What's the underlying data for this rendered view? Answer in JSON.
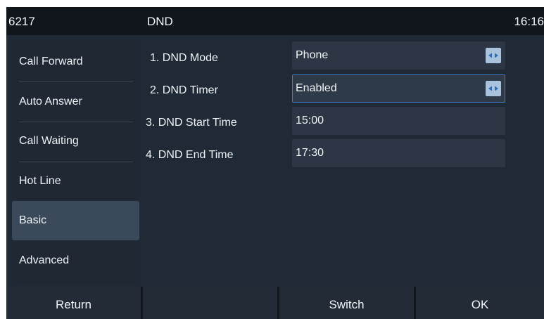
{
  "status_bar": {
    "extension": "6217",
    "screen_title": "DND",
    "time": "16:16"
  },
  "sidebar": {
    "items": [
      {
        "label": "Call Forward"
      },
      {
        "label": "Auto Answer"
      },
      {
        "label": "Call Waiting"
      },
      {
        "label": "Hot Line"
      },
      {
        "label": "Basic",
        "selected": true
      },
      {
        "label": "Advanced"
      }
    ]
  },
  "settings": {
    "rows": [
      {
        "label": "1. DND Mode",
        "value": "Phone",
        "control": "selector"
      },
      {
        "label": "2. DND Timer",
        "value": "Enabled",
        "control": "selector",
        "focused": true
      },
      {
        "label": "3. DND Start Time",
        "value": "15:00",
        "control": "text"
      },
      {
        "label": "4. DND End Time",
        "value": "17:30",
        "control": "text"
      }
    ]
  },
  "softkeys": {
    "key1": "Return",
    "key2": "",
    "key3": "Switch",
    "key4": "OK"
  },
  "icons": {
    "selector": "left-right-arrows-icon"
  },
  "colors": {
    "background": "#202a36",
    "bar": "#11161d",
    "selected": "#3b4a5b",
    "focus_border": "#3f7fd0",
    "selector_button": "#a9c3dc"
  }
}
